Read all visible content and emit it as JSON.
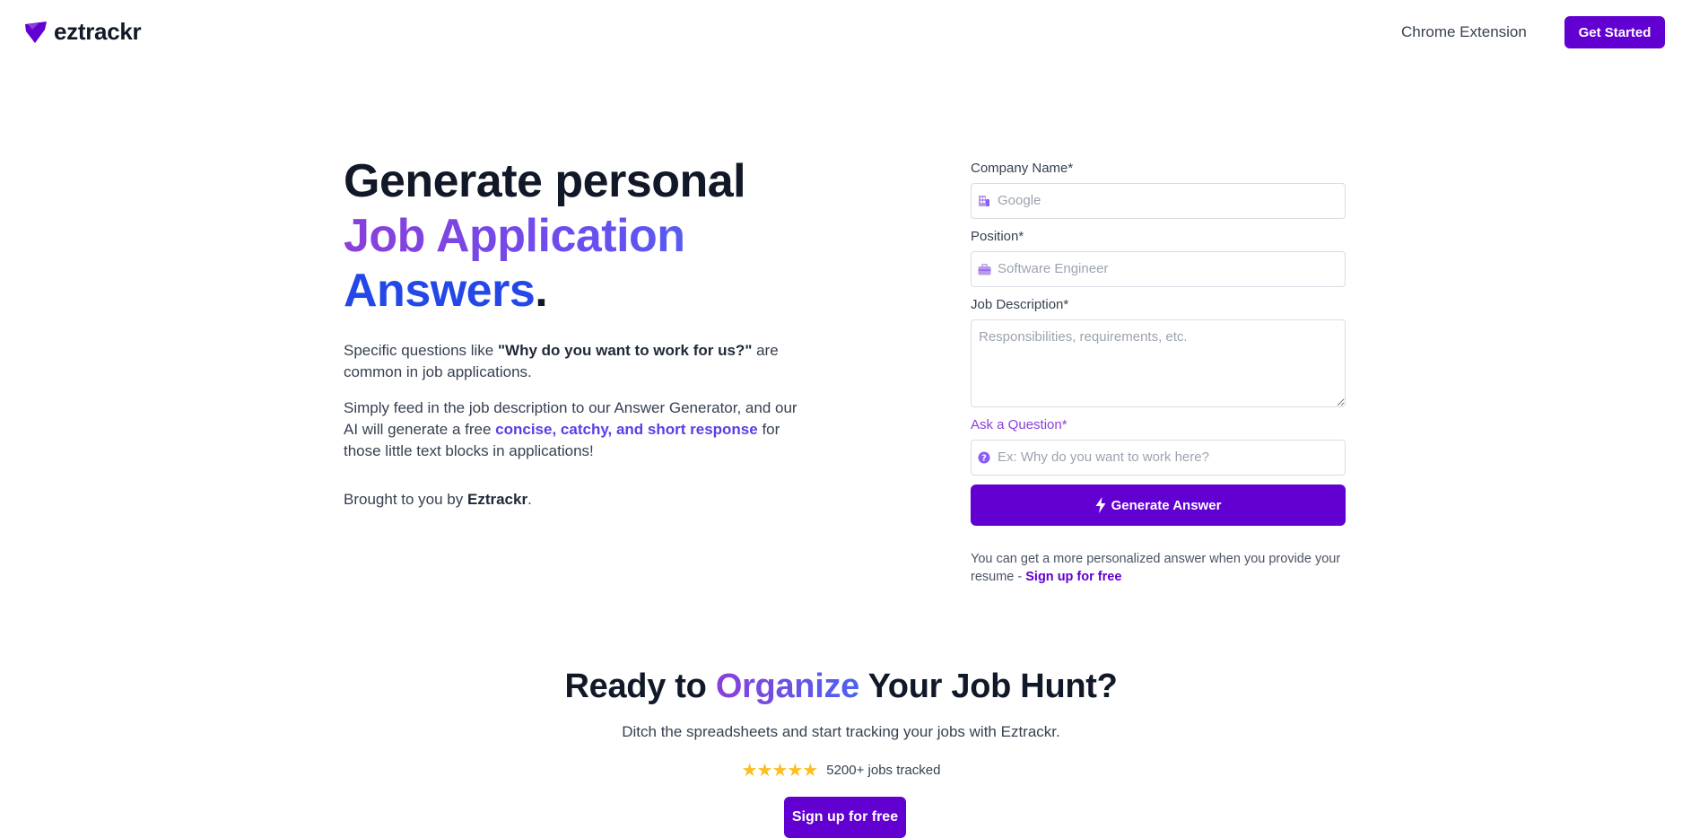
{
  "header": {
    "logo_text": "eztrackr",
    "nav_link": "Chrome Extension",
    "cta_label": "Get Started",
    "brand_color": "#6200d2"
  },
  "hero": {
    "title_line1": "Generate personal",
    "title_line2": "Job Application",
    "title_line3": "Answers",
    "title_dot": ".",
    "p1_pre": "Specific questions like ",
    "p1_bold": "\"Why do you want to work for us?\"",
    "p1_post": " are common in job applications.",
    "p2_pre": "Simply feed in the job description to our Answer Generator, and our AI will generate a free ",
    "p2_highlight": "concise, catchy, and short response",
    "p2_post": " for those little text blocks in applications!",
    "p3_pre": "Brought to you by ",
    "p3_bold": "Eztrackr",
    "p3_post": "."
  },
  "form": {
    "company": {
      "label": "Company Name*",
      "placeholder": "Google",
      "value": "",
      "icon": "building-icon"
    },
    "position": {
      "label": "Position*",
      "placeholder": "Software Engineer",
      "value": "",
      "icon": "briefcase-icon"
    },
    "description": {
      "label": "Job Description*",
      "placeholder": "Responsibilities, requirements, etc.",
      "value": ""
    },
    "question": {
      "label": "Ask a Question*",
      "placeholder": "Ex: Why do you want to work here?",
      "value": "",
      "icon": "question-circle-icon"
    },
    "submit_label": "Generate Answer",
    "note_text": "You can get a more personalized answer when you provide your resume - ",
    "note_link": "Sign up for free"
  },
  "cta": {
    "title_pre": "Ready to ",
    "title_highlight": "Organize",
    "title_post": " Your Job Hunt?",
    "subtitle": "Ditch the spreadsheets and start tracking your jobs with Eztrackr.",
    "stars": "★★★★★",
    "rating": 5,
    "jobs_tracked": "5200+ jobs tracked",
    "button_label": "Sign up for free"
  },
  "colors": {
    "primary": "#6200d2",
    "purple_text": "#8b3fd9",
    "blue_text": "#2448e8",
    "star": "#fbbf24"
  }
}
